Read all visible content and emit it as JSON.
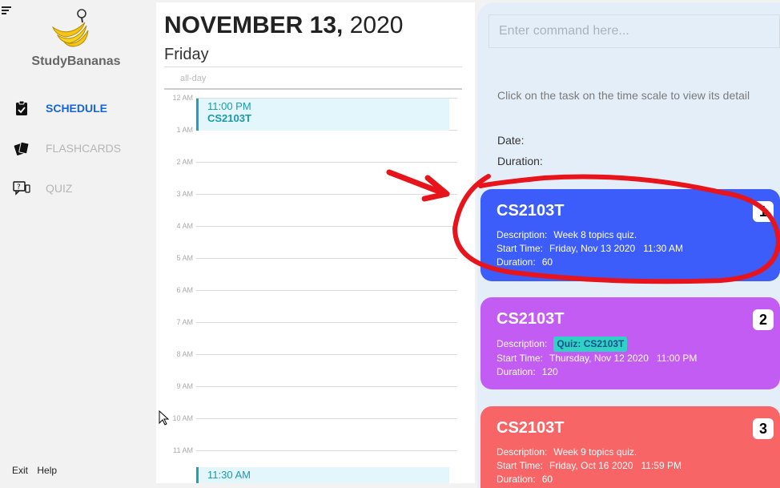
{
  "app": {
    "name": "StudyBananas"
  },
  "nav": {
    "items": [
      {
        "label": "SCHEDULE",
        "icon": "clipboard-icon",
        "active": true
      },
      {
        "label": "FLASHCARDS",
        "icon": "cards-icon",
        "active": false
      },
      {
        "label": "QUIZ",
        "icon": "quiz-icon",
        "active": false
      }
    ]
  },
  "footer": {
    "exit": "Exit",
    "help": "Help"
  },
  "calendar": {
    "date_bold": "NOVEMBER 13,",
    "year": "2020",
    "weekday": "Friday",
    "allday_label": "all-day",
    "hours": [
      "12 AM",
      "1 AM",
      "2 AM",
      "3 AM",
      "4 AM",
      "5 AM",
      "6 AM",
      "7 AM",
      "8 AM",
      "9 AM",
      "10 AM",
      "11 AM"
    ],
    "events": [
      {
        "time": "11:00 PM",
        "title": "CS2103T"
      },
      {
        "time": "11:30 AM",
        "title": ""
      }
    ]
  },
  "command": {
    "placeholder": "Enter command here..."
  },
  "detail": {
    "hint": "Click on the task on the time scale to view its detail",
    "date_label": "Date:",
    "duration_label": "Duration:"
  },
  "tasks": [
    {
      "index": "1",
      "title": "CS2103T",
      "description_label": "Description:",
      "description": "Week 8 topics quiz.",
      "start_label": "Start Time:",
      "start": "Friday, Nov 13 2020   11:30 AM",
      "duration_label": "Duration:",
      "duration": "60",
      "color": "#3c5dfa"
    },
    {
      "index": "2",
      "title": "CS2103T",
      "description_label": "Description:",
      "description": "Quiz: CS2103T",
      "start_label": "Start Time:",
      "start": "Thursday, Nov 12 2020   11:00 PM",
      "duration_label": "Duration:",
      "duration": "120",
      "color": "#c35cf2"
    },
    {
      "index": "3",
      "title": "CS2103T",
      "description_label": "Description:",
      "description": "Week 9 topics quiz.",
      "start_label": "Start Time:",
      "start": "Friday, Oct 16 2020   11:59 PM",
      "duration_label": "Duration:",
      "duration": "60",
      "color": "#f86566"
    }
  ]
}
